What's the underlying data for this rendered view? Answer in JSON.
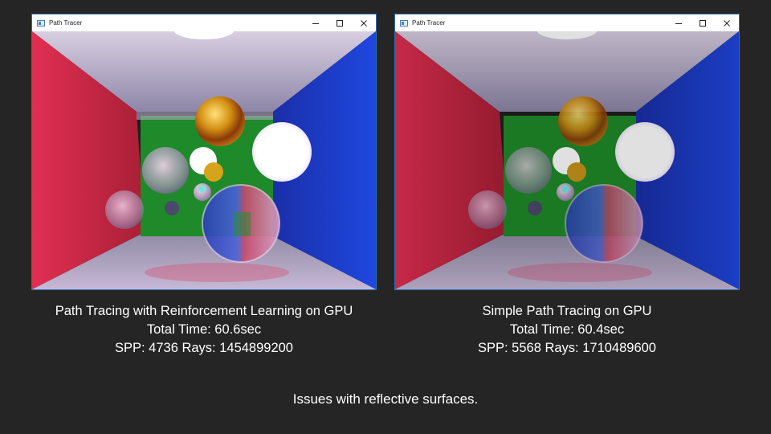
{
  "windows": [
    {
      "title": "Path Tracer",
      "caption": {
        "line1": "Path Tracing with Reinforcement Learning on GPU",
        "line2": "Total Time: 60.6sec",
        "line3": "SPP: 4736 Rays: 1454899200"
      }
    },
    {
      "title": "Path Tracer",
      "caption": {
        "line1": "Simple Path Tracing on GPU",
        "line2": "Total Time: 60.4sec",
        "line3": "SPP: 5568  Rays: 1710489600"
      }
    }
  ],
  "footer": "Issues with reflective surfaces.",
  "colors": {
    "background": "#252525",
    "titlebar": "#ffffff",
    "window_border": "#2c6fb3",
    "left_wall": "#d5304e",
    "right_wall": "#1d3fd0",
    "back_wall": "#1f8a2a",
    "text": "#ffffff"
  },
  "icons": [
    "app-window-icon",
    "minimize-icon",
    "maximize-icon",
    "close-icon"
  ]
}
